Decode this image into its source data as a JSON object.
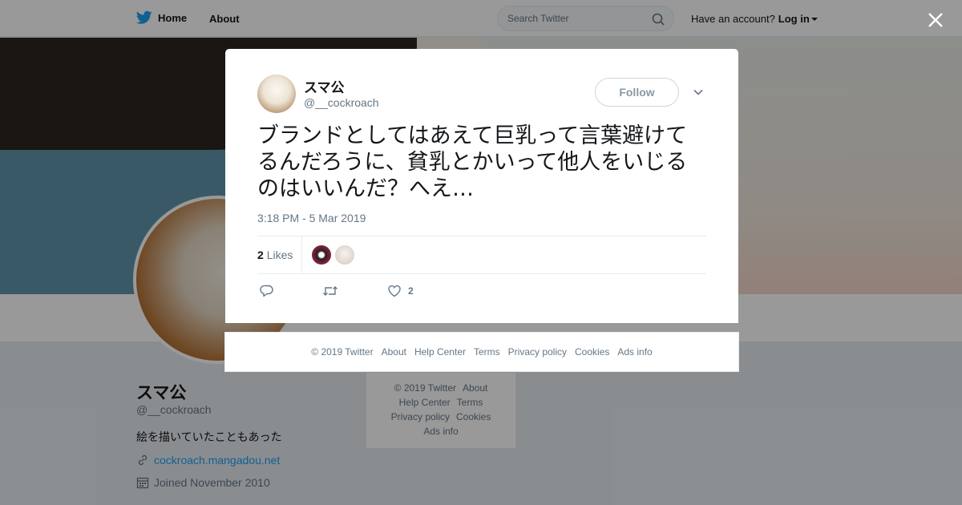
{
  "colors": {
    "brand": "#1da1f2",
    "text": "#14171a",
    "muted": "#657786"
  },
  "nav": {
    "home_label": "Home",
    "about_label": "About"
  },
  "search": {
    "placeholder": "Search Twitter"
  },
  "account": {
    "prompt": "Have an account?",
    "login_label": "Log in"
  },
  "profile": {
    "name": "スマ公",
    "handle": "@__cockroach",
    "bio": "絵を描いていたこともあった",
    "url": "cockroach.mangadou.net",
    "joined": "Joined November 2010"
  },
  "side_footer": {
    "links": [
      "© 2019 Twitter",
      "About",
      "Help Center",
      "Terms",
      "Privacy policy",
      "Cookies",
      "Ads info"
    ]
  },
  "tweet": {
    "author_name": "スマ公",
    "author_handle": "@__cockroach",
    "follow_label": "Follow",
    "text": "ブランドとしてはあえて巨乳って言葉避けてるんだろうに、貧乳とかいって他人をいじるのはいいんだ？へえ…",
    "timestamp": "3:18 PM - 5 Mar 2019",
    "likes_count": "2",
    "likes_label": "Likes",
    "like_action_count": "2"
  },
  "modal_footer": {
    "links": [
      "© 2019 Twitter",
      "About",
      "Help Center",
      "Terms",
      "Privacy policy",
      "Cookies",
      "Ads info"
    ]
  },
  "icons": {
    "logo": "twitter-bird-icon",
    "search": "search-icon",
    "close": "close-icon",
    "reply": "reply-icon",
    "retweet": "retweet-icon",
    "like": "heart-icon",
    "link": "link-icon",
    "calendar": "calendar-icon",
    "caret": "chevron-down-icon"
  }
}
